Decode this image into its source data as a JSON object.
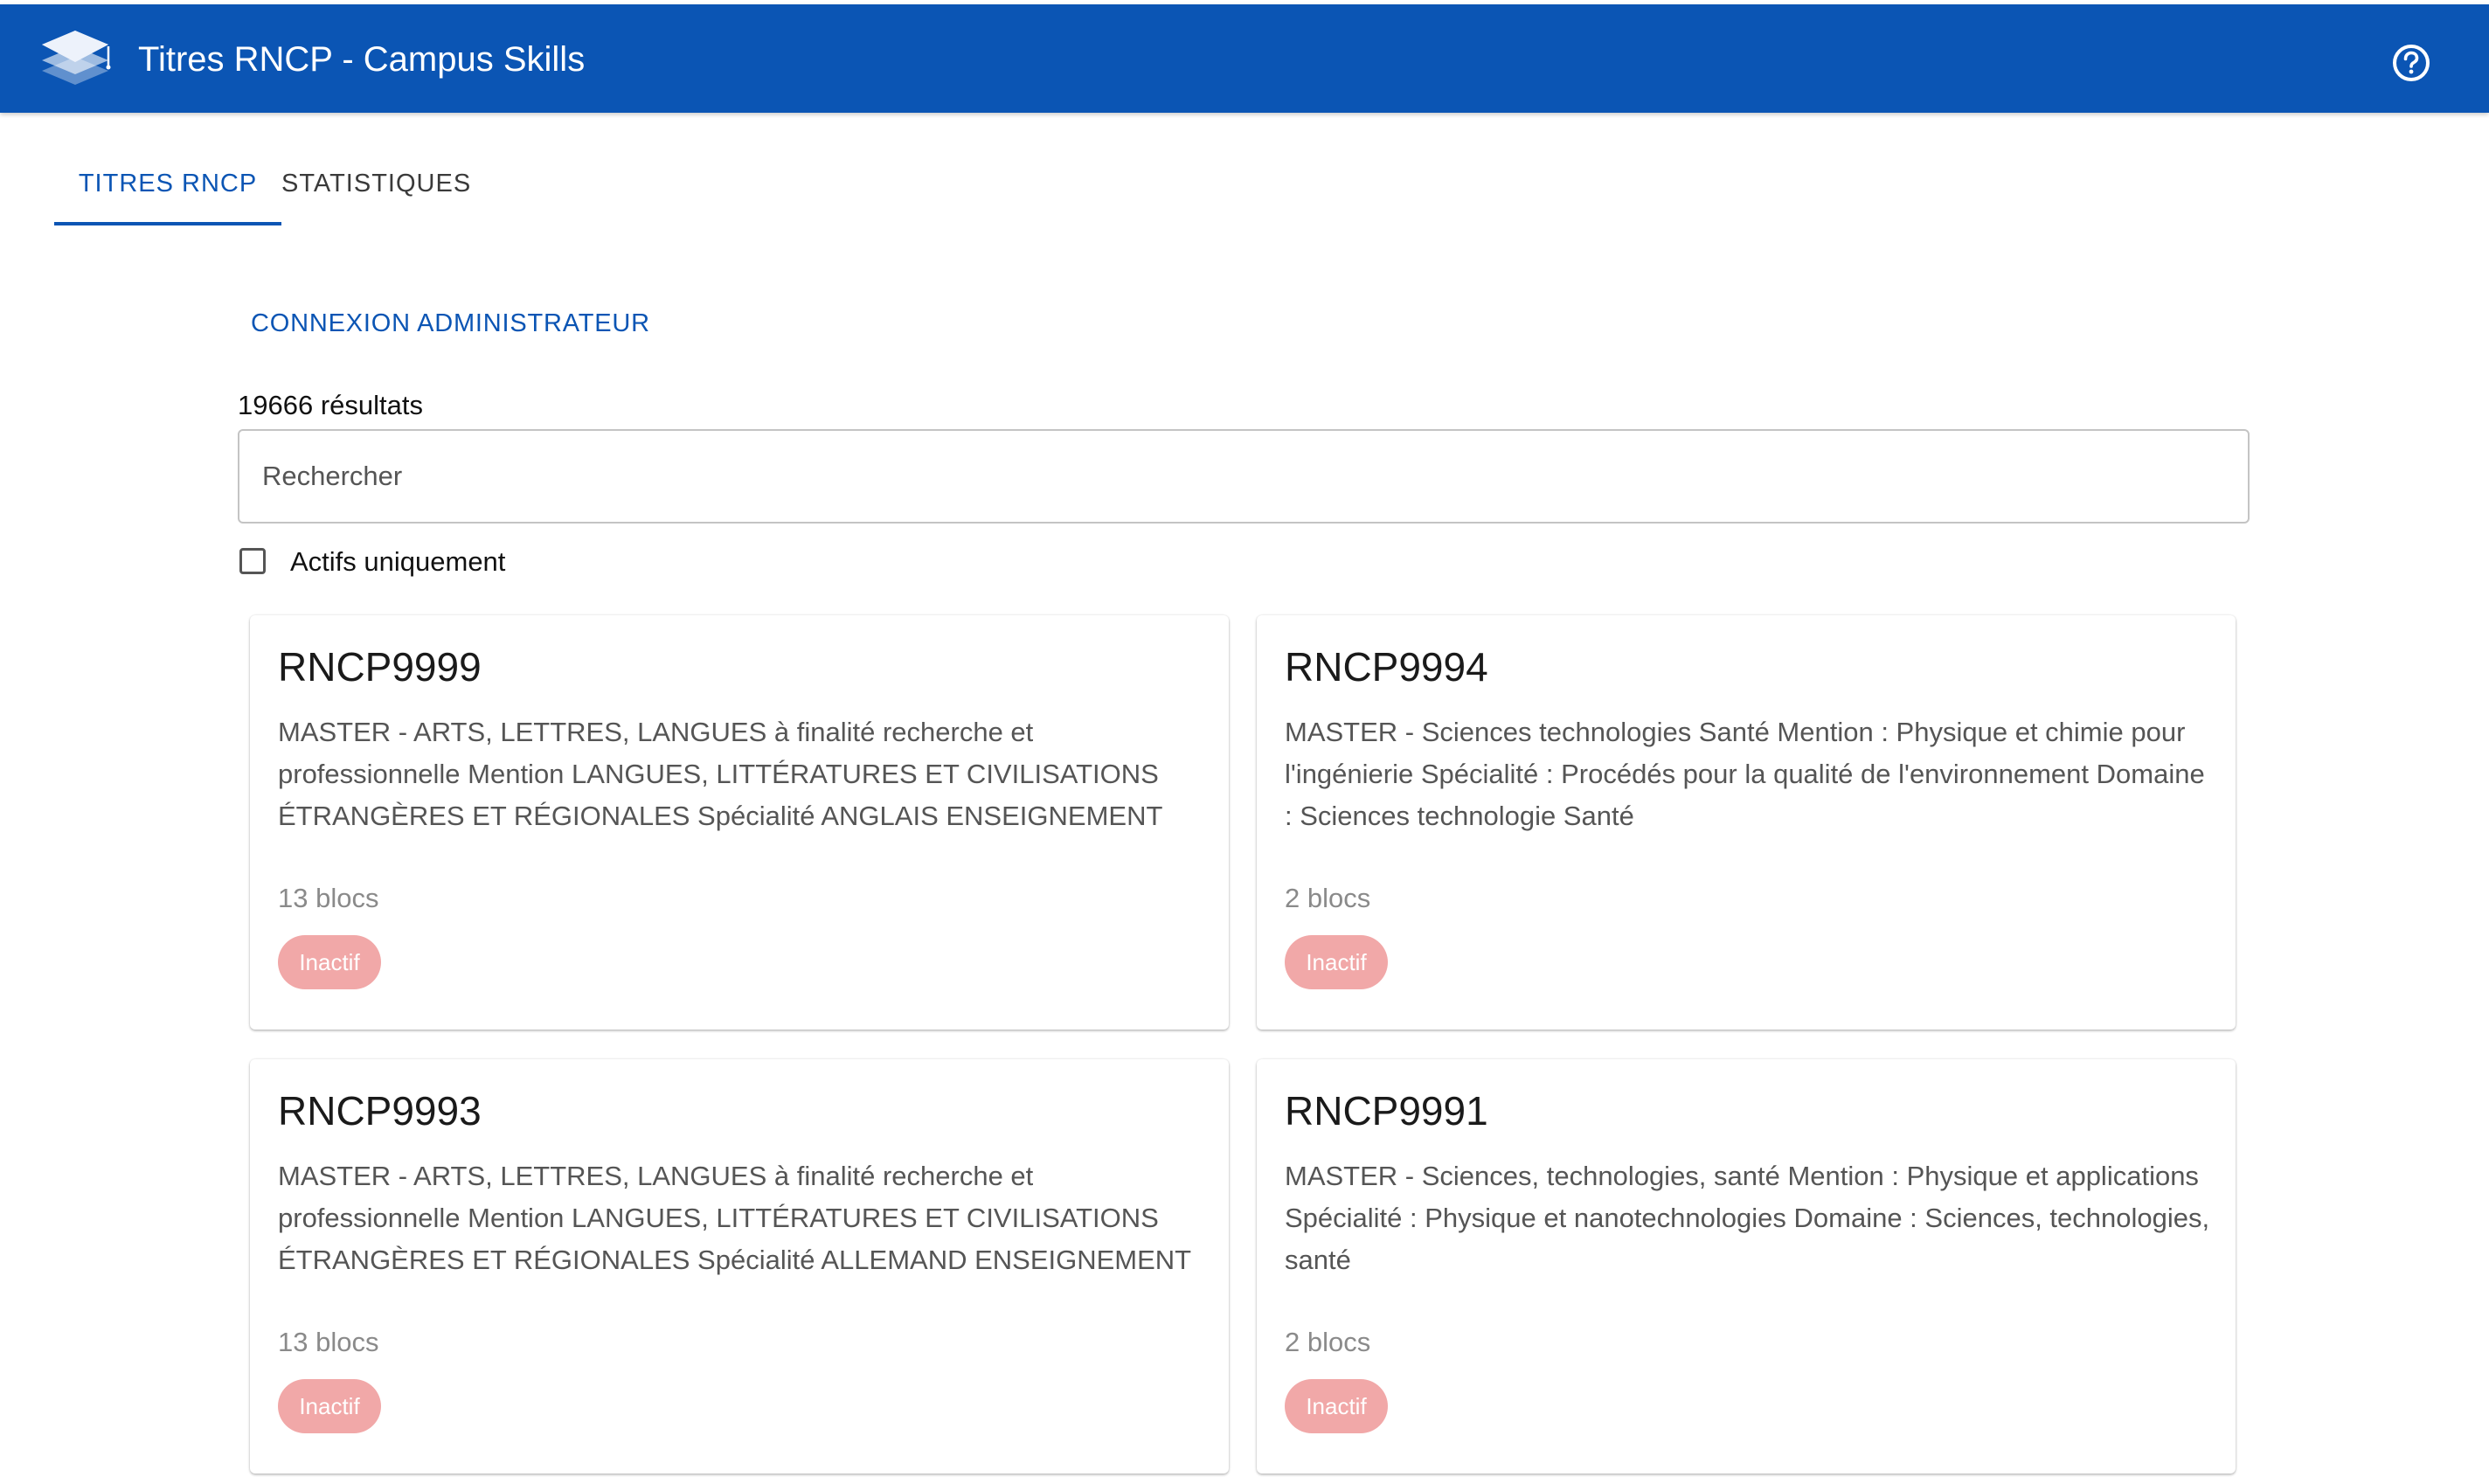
{
  "header": {
    "title": "Titres RNCP - Campus Skills",
    "logo_icon": "graduation-layers-icon",
    "help_icon": "help-circle-icon",
    "bg_color": "#0b55b4"
  },
  "tabs": [
    {
      "label": "TITRES RNCP",
      "active": true
    },
    {
      "label": "STATISTIQUES",
      "active": false
    }
  ],
  "admin_link": "CONNEXION ADMINISTRATEUR",
  "results": {
    "count_label": "19666 résultats"
  },
  "search": {
    "placeholder": "Rechercher",
    "value": ""
  },
  "filter": {
    "label": "Actifs uniquement",
    "checked": false
  },
  "cards": [
    {
      "code": "RNCP9999",
      "description": "MASTER - ARTS, LETTRES, LANGUES à finalité recherche et professionnelle Mention LANGUES, LITTÉRATURES ET CIVILISATIONS ÉTRANGÈRES ET RÉGIONALES Spécialité ANGLAIS ENSEIGNEMENT",
      "blocks": "13 blocs",
      "status": "Inactif"
    },
    {
      "code": "RNCP9994",
      "description": "MASTER - Sciences technologies Santé Mention : Physique et chimie pour l'ingénierie Spécialité : Procédés pour la qualité de l'environnement Domaine : Sciences technologie Santé",
      "blocks": "2 blocs",
      "status": "Inactif"
    },
    {
      "code": "RNCP9993",
      "description": "MASTER - ARTS, LETTRES, LANGUES à finalité recherche et professionnelle Mention LANGUES, LITTÉRATURES ET CIVILISATIONS ÉTRANGÈRES ET RÉGIONALES Spécialité ALLEMAND ENSEIGNEMENT",
      "blocks": "13 blocs",
      "status": "Inactif"
    },
    {
      "code": "RNCP9991",
      "description": "MASTER - Sciences, technologies, santé Mention : Physique et applications Spécialité : Physique et nanotechnologies Domaine : Sciences, technologies, santé",
      "blocks": "2 blocs",
      "status": "Inactif"
    }
  ],
  "colors": {
    "accent": "#0b55b4",
    "inactive_badge": "#f1a8a8"
  }
}
